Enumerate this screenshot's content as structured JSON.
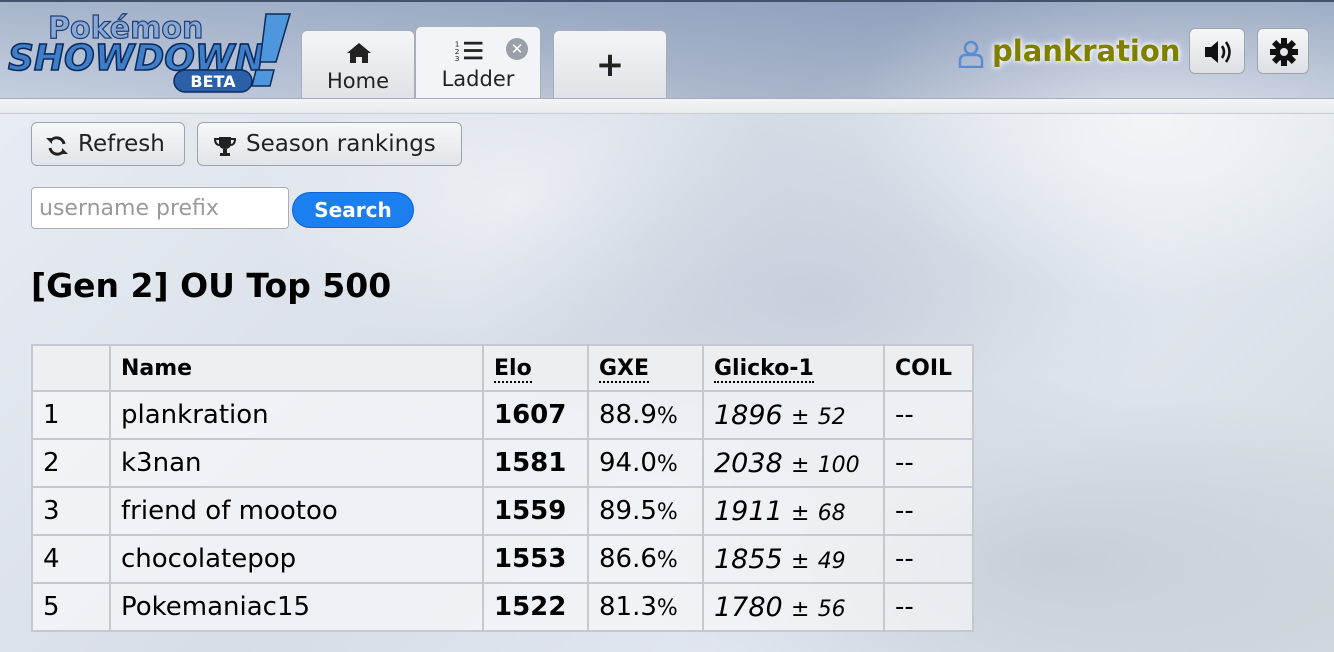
{
  "app": {
    "logo_top": "Pokémon",
    "logo_main": "SHOWDOWN",
    "logo_badge": "BETA"
  },
  "tabs": [
    {
      "label": "Home",
      "icon": "home-icon"
    },
    {
      "label": "Ladder",
      "icon": "ordered-list-icon",
      "active": true,
      "closable": true
    },
    {
      "label": "+",
      "icon": "plus-icon"
    }
  ],
  "user": {
    "name": "plankration",
    "name_color": "#808000"
  },
  "header_buttons": [
    {
      "icon": "volume-icon"
    },
    {
      "icon": "gear-icon"
    }
  ],
  "toolbar": {
    "refresh_label": "Refresh",
    "season_label": "Season rankings"
  },
  "search": {
    "placeholder": "username prefix",
    "value": "",
    "button_label": "Search",
    "button_color": "#1b7ff0"
  },
  "ladder": {
    "title": "[Gen 2] OU Top 500",
    "columns": [
      "",
      "Name",
      "Elo",
      "GXE",
      "Glicko-1",
      "COIL"
    ],
    "rows": [
      {
        "rank": "1",
        "name": "plankration",
        "elo": "1607",
        "gxe": "88.9",
        "glicko": "1896",
        "dev": "52",
        "coil": "--"
      },
      {
        "rank": "2",
        "name": "k3nan",
        "elo": "1581",
        "gxe": "94.0",
        "glicko": "2038",
        "dev": "100",
        "coil": "--"
      },
      {
        "rank": "3",
        "name": "friend of mootoo",
        "elo": "1559",
        "gxe": "89.5",
        "glicko": "1911",
        "dev": "68",
        "coil": "--"
      },
      {
        "rank": "4",
        "name": "chocolatepop",
        "elo": "1553",
        "gxe": "86.6",
        "glicko": "1855",
        "dev": "49",
        "coil": "--"
      },
      {
        "rank": "5",
        "name": "Pokemaniac15",
        "elo": "1522",
        "gxe": "81.3",
        "glicko": "1780",
        "dev": "56",
        "coil": "--"
      }
    ],
    "pct_sign": "%",
    "plus_minus": "±"
  }
}
